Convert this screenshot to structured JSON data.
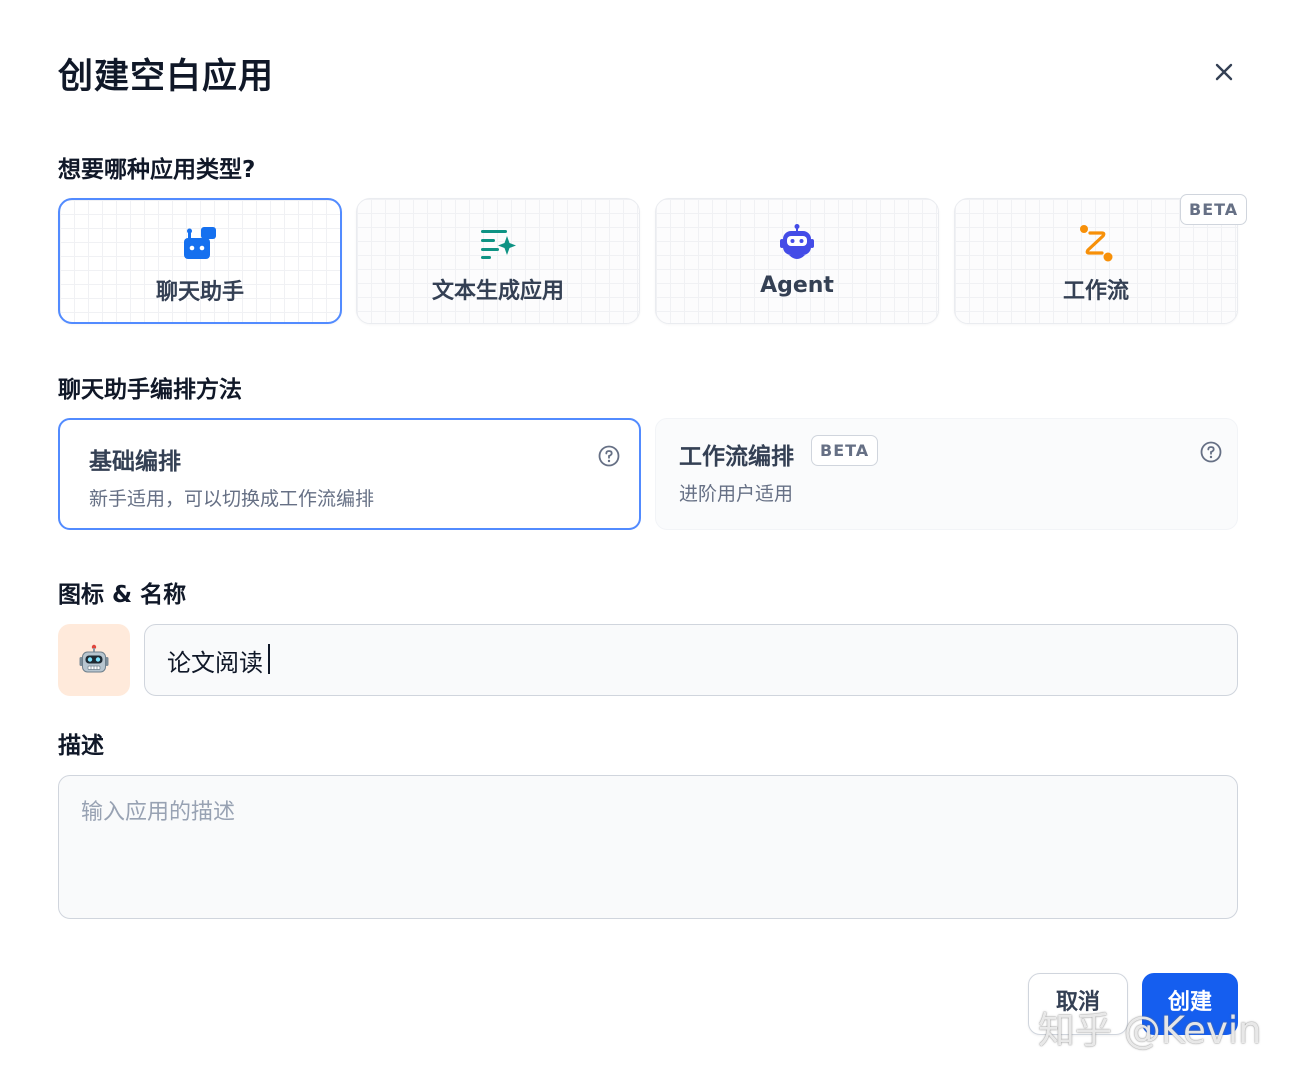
{
  "dialog": {
    "title": "创建空白应用"
  },
  "app_type": {
    "label": "想要哪种应用类型?",
    "options": [
      {
        "label": "聊天助手",
        "icon": "chat-bot-icon",
        "color": "#1570ef",
        "selected": true
      },
      {
        "label": "文本生成应用",
        "icon": "text-sparkle-icon",
        "color": "#0e9384",
        "selected": false
      },
      {
        "label": "Agent",
        "icon": "robot-icon",
        "color": "#444ce7",
        "selected": false
      },
      {
        "label": "工作流",
        "icon": "workflow-icon",
        "color": "#f79009",
        "selected": false,
        "badge": "BETA"
      }
    ]
  },
  "orchestration": {
    "label": "聊天助手编排方法",
    "basic": {
      "title": "基础编排",
      "desc": "新手适用，可以切换成工作流编排",
      "selected": true
    },
    "workflow": {
      "title": "工作流编排",
      "badge": "BETA",
      "desc": "进阶用户适用",
      "selected": false
    }
  },
  "icon_name": {
    "label": "图标 & 名称",
    "emoji": "robot-emoji-icon",
    "emoji_bg": "#ffeadb",
    "name_value": "论文阅读"
  },
  "description": {
    "label": "描述",
    "placeholder": "输入应用的描述",
    "value": ""
  },
  "actions": {
    "cancel": "取消",
    "create": "创建"
  },
  "watermark": "知乎 @Kevin",
  "colors": {
    "accent": "#155eef",
    "selected_border": "#528bff"
  }
}
